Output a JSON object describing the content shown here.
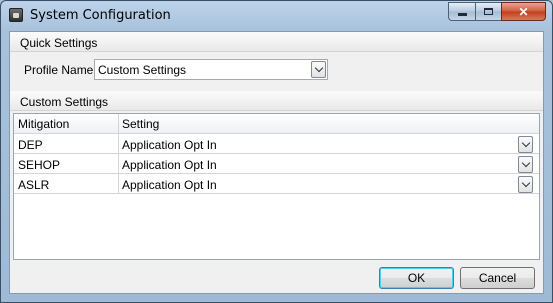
{
  "window": {
    "title": "System Configuration",
    "icon": "settings-icon"
  },
  "caption": {
    "minimize": "",
    "maximize": "",
    "close": "✕"
  },
  "quick_settings": {
    "header": "Quick Settings",
    "profile_label": "Profile Name",
    "profile_value": "Custom Settings"
  },
  "custom_settings": {
    "header": "Custom Settings",
    "columns": [
      "Mitigation",
      "Setting"
    ],
    "rows": [
      {
        "mitigation": "DEP",
        "setting": "Application Opt In"
      },
      {
        "mitigation": "SEHOP",
        "setting": "Application Opt In"
      },
      {
        "mitigation": "ASLR",
        "setting": "Application Opt In"
      }
    ]
  },
  "buttons": {
    "ok": "OK",
    "cancel": "Cancel"
  },
  "colors": {
    "title_bar": "#a8c2dc",
    "close_button": "#c23d1c",
    "client_bg": "#f0f0f0"
  }
}
